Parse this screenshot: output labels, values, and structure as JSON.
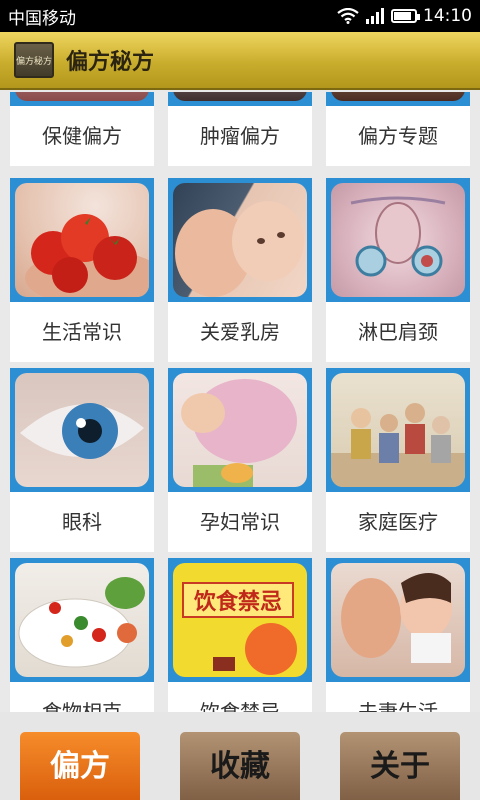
{
  "status": {
    "carrier": "中国移动",
    "time": "14:10",
    "battery_level": 0.85
  },
  "header": {
    "title": "偏方秘方",
    "logo_text": "偏方秘方"
  },
  "grid": {
    "items": [
      {
        "label": "保健偏方"
      },
      {
        "label": "肿瘤偏方"
      },
      {
        "label": "偏方专题"
      },
      {
        "label": "生活常识"
      },
      {
        "label": "关爱乳房"
      },
      {
        "label": "淋巴肩颈"
      },
      {
        "label": "眼科"
      },
      {
        "label": "孕妇常识"
      },
      {
        "label": "家庭医疗"
      },
      {
        "label": "食物相克"
      },
      {
        "label": "饮食禁忌"
      },
      {
        "label": "夫妻生活"
      }
    ],
    "poster_text": "饮食禁忌"
  },
  "tabs": [
    {
      "label": "偏方",
      "active": true
    },
    {
      "label": "收藏",
      "active": false
    },
    {
      "label": "关于",
      "active": false
    }
  ]
}
